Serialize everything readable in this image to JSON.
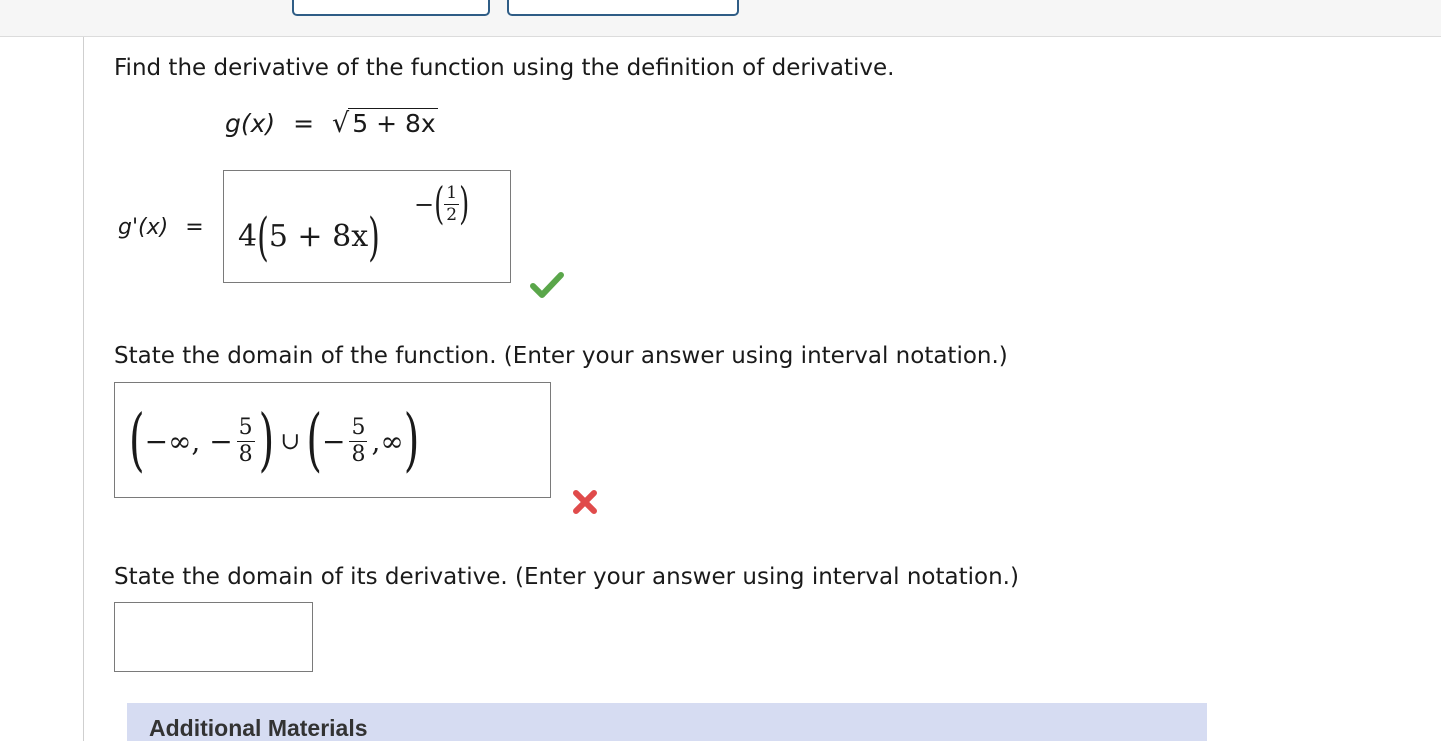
{
  "question": {
    "prompt": "Find the derivative of the function using the definition of derivative.",
    "function_lhs": "g(x)",
    "equals": "=",
    "radicand": "5 + 8x"
  },
  "part1": {
    "label": "g'(x)",
    "equals": "=",
    "answer": {
      "coef": "4",
      "inner": "5 + 8x",
      "exp_sign": "−",
      "exp_num": "1",
      "exp_den": "2"
    },
    "status": "correct",
    "status_color": "#5aa64a"
  },
  "part2": {
    "prompt": "State the domain of the function. (Enter your answer using interval notation.)",
    "answer": {
      "left_a": "−∞, −",
      "num1": "5",
      "den1": "8",
      "union": "∪",
      "left_b": "−",
      "num2": "5",
      "den2": "8",
      "right_b": ",∞"
    },
    "status": "incorrect",
    "status_color": "#e04b4b"
  },
  "part3": {
    "prompt": "State the domain of its derivative. (Enter your answer using interval notation.)",
    "input_value": ""
  },
  "materials": {
    "label": "Additional Materials"
  }
}
